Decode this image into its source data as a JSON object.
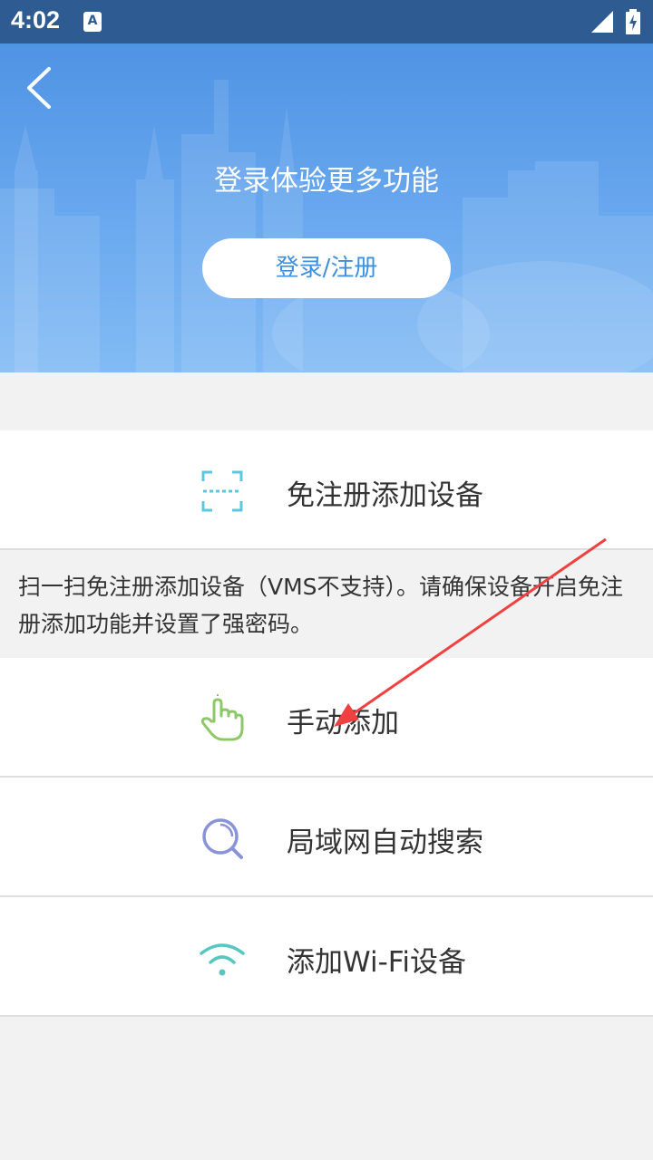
{
  "status_bar": {
    "time": "4:02",
    "notification_icon": "A"
  },
  "header": {
    "back_icon": "chevron-left",
    "title": "登录体验更多功能",
    "login_label": "登录/注册"
  },
  "options": [
    {
      "icon": "scan-frame-icon",
      "label": "免注册添加设备",
      "color": "#5bc8e0"
    },
    {
      "icon": "hand-pointer-icon",
      "label": "手动添加",
      "color": "#8dc868"
    },
    {
      "icon": "search-icon",
      "label": "局域网自动搜索",
      "color": "#8a92d8"
    },
    {
      "icon": "wifi-icon",
      "label": "添加Wi-Fi设备",
      "color": "#55c7c0"
    }
  ],
  "scan_description": "扫一扫免注册添加设备（VMS不支持）。请确保设备开启免注册添加功能并设置了强密码。",
  "colors": {
    "header_blue": "#4f93e4",
    "status_bar": "#2f5b93",
    "annotation_arrow": "#f04040"
  }
}
